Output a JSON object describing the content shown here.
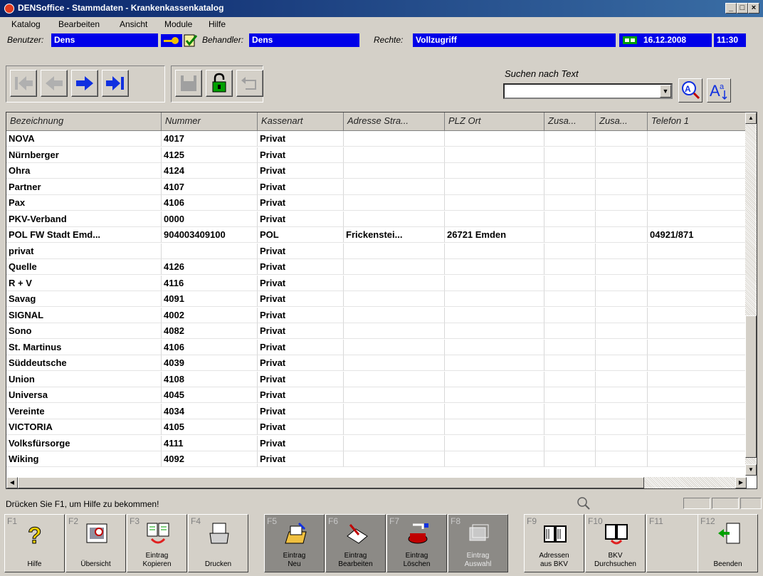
{
  "window": {
    "title": "DENSoffice - Stammdaten - Krankenkassenkatalog"
  },
  "menu": [
    "Katalog",
    "Bearbeiten",
    "Ansicht",
    "Module",
    "Hilfe"
  ],
  "info": {
    "user_label": "Benutzer:",
    "user": "Dens",
    "doctor_label": "Behandler:",
    "doctor": "Dens",
    "rights_label": "Rechte:",
    "rights": "Vollzugriff",
    "date": "16.12.2008",
    "time": "11:30"
  },
  "search": {
    "label": "Suchen nach Text",
    "value": ""
  },
  "columns": [
    "Bezeichnung",
    "Nummer",
    "Kassenart",
    "Adresse Stra...",
    "PLZ Ort",
    "Zusa...",
    "Zusa...",
    "Telefon 1"
  ],
  "rows": [
    [
      "NOVA",
      "4017",
      "Privat",
      "",
      "",
      "",
      "",
      ""
    ],
    [
      "Nürnberger",
      "4125",
      "Privat",
      "",
      "",
      "",
      "",
      ""
    ],
    [
      "Ohra",
      "4124",
      "Privat",
      "",
      "",
      "",
      "",
      ""
    ],
    [
      "Partner",
      "4107",
      "Privat",
      "",
      "",
      "",
      "",
      ""
    ],
    [
      "Pax",
      "4106",
      "Privat",
      "",
      "",
      "",
      "",
      ""
    ],
    [
      "PKV-Verband",
      "0000",
      "Privat",
      "",
      "",
      "",
      "",
      ""
    ],
    [
      "POL FW Stadt  Emd...",
      "904003409100",
      "POL",
      "Frickenstei...",
      "26721 Emden",
      "",
      "",
      "04921/871"
    ],
    [
      "privat",
      "",
      "Privat",
      "",
      "",
      "",
      "",
      ""
    ],
    [
      "Quelle",
      "4126",
      "Privat",
      "",
      "",
      "",
      "",
      ""
    ],
    [
      "R + V",
      "4116",
      "Privat",
      "",
      "",
      "",
      "",
      ""
    ],
    [
      "Savag",
      "4091",
      "Privat",
      "",
      "",
      "",
      "",
      ""
    ],
    [
      "SIGNAL",
      "4002",
      "Privat",
      "",
      "",
      "",
      "",
      ""
    ],
    [
      "Sono",
      "4082",
      "Privat",
      "",
      "",
      "",
      "",
      ""
    ],
    [
      "St. Martinus",
      "4106",
      "Privat",
      "",
      "",
      "",
      "",
      ""
    ],
    [
      "Süddeutsche",
      "4039",
      "Privat",
      "",
      "",
      "",
      "",
      ""
    ],
    [
      "Union",
      "4108",
      "Privat",
      "",
      "",
      "",
      "",
      ""
    ],
    [
      "Universa",
      "4045",
      "Privat",
      "",
      "",
      "",
      "",
      ""
    ],
    [
      "Vereinte",
      "4034",
      "Privat",
      "",
      "",
      "",
      "",
      ""
    ],
    [
      "VICTORIA",
      "4105",
      "Privat",
      "",
      "",
      "",
      "",
      ""
    ],
    [
      "Volksfürsorge",
      "4111",
      "Privat",
      "",
      "",
      "",
      "",
      ""
    ],
    [
      "Wiking",
      "4092",
      "Privat",
      "",
      "",
      "",
      "",
      ""
    ]
  ],
  "status": {
    "text": "Drücken Sie F1, um Hilfe zu bekommen!"
  },
  "fkeys": [
    {
      "num": "F1",
      "label": "Hilfe",
      "icon": "help-icon"
    },
    {
      "num": "F2",
      "label": "Übersicht",
      "icon": "overview-icon"
    },
    {
      "num": "F3",
      "label": "Eintrag\nKopieren",
      "icon": "copy-icon"
    },
    {
      "num": "F4",
      "label": "Drucken",
      "icon": "printer-icon"
    },
    {
      "num": "F5",
      "label": "Eintrag\nNeu",
      "icon": "new-entry-icon"
    },
    {
      "num": "F6",
      "label": "Eintrag\nBearbeiten",
      "icon": "edit-icon"
    },
    {
      "num": "F7",
      "label": "Eintrag\nLöschen",
      "icon": "delete-icon"
    },
    {
      "num": "F8",
      "label": "Eintrag\nAuswahl",
      "icon": "select-icon"
    },
    {
      "num": "F9",
      "label": "Adressen\naus BKV",
      "icon": "book-icon"
    },
    {
      "num": "F10",
      "label": "BKV\nDurchsuchen",
      "icon": "book-search-icon"
    },
    {
      "num": "F11",
      "label": "",
      "icon": ""
    },
    {
      "num": "F12",
      "label": "Beenden",
      "icon": "exit-icon"
    }
  ]
}
